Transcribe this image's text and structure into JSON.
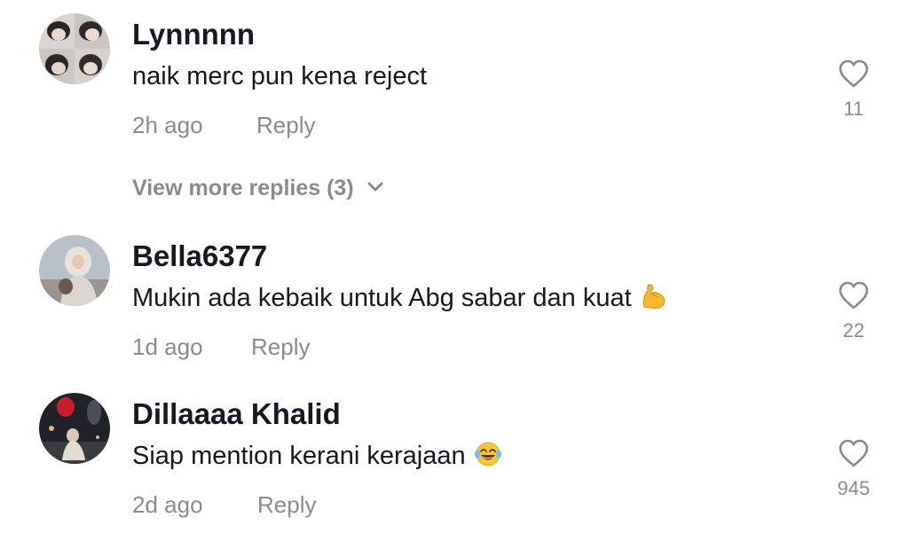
{
  "comments": [
    {
      "username": "Lynnnnn",
      "text": "naik merc pun kena reject",
      "time": "2h ago",
      "reply_label": "Reply",
      "likes": "11",
      "view_more": "View more replies (3)"
    },
    {
      "username": "Bella6377",
      "text": "Mukin ada kebaik untuk Abg sabar dan kuat",
      "emoji": "flexed-biceps-emoji",
      "time": "1d ago",
      "reply_label": "Reply",
      "likes": "22"
    },
    {
      "username": "Dillaaaa Khalid",
      "text": "Siap mention kerani kerajaan",
      "emoji": "tears-of-joy-emoji",
      "time": "2d ago",
      "reply_label": "Reply",
      "likes": "945"
    }
  ],
  "colors": {
    "primary_text": "#161823",
    "secondary_text": "#8a8b91",
    "background": "#ffffff"
  }
}
